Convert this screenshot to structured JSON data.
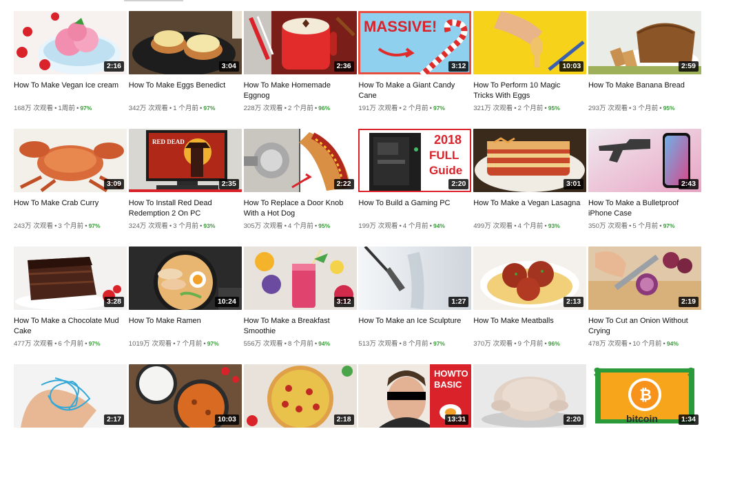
{
  "colors": {
    "percent": "#3a9b3a",
    "duration_bg": "#000000"
  },
  "videos": [
    {
      "title": "How To Make Vegan Ice cream",
      "views": "168万 次观看",
      "age": "1周前",
      "like": "97%",
      "duration": "2:16",
      "thumb": "ice-cream"
    },
    {
      "title": "How To Make Eggs Benedict",
      "views": "342万 次观看",
      "age": "1 个月前",
      "like": "97%",
      "duration": "3:04",
      "thumb": "eggs-benedict"
    },
    {
      "title": "How To Make Homemade Eggnog",
      "views": "228万 次观看",
      "age": "2 个月前",
      "like": "96%",
      "duration": "2:36",
      "thumb": "eggnog"
    },
    {
      "title": "How To Make a Giant Candy Cane",
      "views": "191万 次观看",
      "age": "2 个月前",
      "like": "97%",
      "duration": "3:12",
      "thumb": "candy-cane",
      "thumb_text": "MASSIVE!"
    },
    {
      "title": "How To Perform 10 Magic Tricks With Eggs",
      "views": "321万 次观看",
      "age": "2 个月前",
      "like": "95%",
      "duration": "10:03",
      "thumb": "egg-tricks"
    },
    {
      "title": "How To Make Banana Bread",
      "views": "293万 次观看",
      "age": "3 个月前",
      "like": "95%",
      "duration": "2:59",
      "thumb": "banana-bread"
    },
    {
      "title": "How To Make Crab Curry",
      "views": "243万 次观看",
      "age": "3 个月前",
      "like": "97%",
      "duration": "3:09",
      "thumb": "crab"
    },
    {
      "title": "How To Install Red Dead Redemption 2 On PC",
      "views": "324万 次观看",
      "age": "3 个月前",
      "like": "93%",
      "duration": "2:35",
      "thumb": "red-dead",
      "thumb_text": "RED DEAD"
    },
    {
      "title": "How To Replace a Door Knob With a Hot Dog",
      "views": "305万 次观看",
      "age": "4 个月前",
      "like": "95%",
      "duration": "2:22",
      "thumb": "hotdog"
    },
    {
      "title": "How To Build a Gaming PC",
      "views": "199万 次观看",
      "age": "4 个月前",
      "like": "94%",
      "duration": "2:20",
      "thumb": "gaming-pc",
      "thumb_text": [
        "2018",
        "FULL",
        "Guide"
      ]
    },
    {
      "title": "How To Make a Vegan Lasagna",
      "views": "499万 次观看",
      "age": "4 个月前",
      "like": "93%",
      "duration": "3:01",
      "thumb": "lasagna"
    },
    {
      "title": "How To Make a Bulletproof iPhone Case",
      "views": "350万 次观看",
      "age": "5 个月前",
      "like": "97%",
      "duration": "2:43",
      "thumb": "iphone"
    },
    {
      "title": "How To Make a Chocolate Mud Cake",
      "views": "477万 次观看",
      "age": "6 个月前",
      "like": "97%",
      "duration": "3:28",
      "thumb": "mud-cake"
    },
    {
      "title": "How To Make Ramen",
      "views": "1019万 次观看",
      "age": "7 个月前",
      "like": "97%",
      "duration": "10:24",
      "thumb": "ramen"
    },
    {
      "title": "How To Make a Breakfast Smoothie",
      "views": "556万 次观看",
      "age": "8 个月前",
      "like": "94%",
      "duration": "3:12",
      "thumb": "smoothie"
    },
    {
      "title": "How To Make an Ice Sculpture",
      "views": "513万 次观看",
      "age": "8 个月前",
      "like": "97%",
      "duration": "1:27",
      "thumb": "ice-sculpture"
    },
    {
      "title": "How To Make Meatballs",
      "views": "370万 次观看",
      "age": "9 个月前",
      "like": "96%",
      "duration": "2:13",
      "thumb": "meatballs"
    },
    {
      "title": "How To Cut an Onion Without Crying",
      "views": "478万 次观看",
      "age": "10 个月前",
      "like": "94%",
      "duration": "2:19",
      "thumb": "onion"
    },
    {
      "title": "",
      "views": "",
      "age": "",
      "like": "",
      "duration": "2:17",
      "thumb": "string"
    },
    {
      "title": "",
      "views": "",
      "age": "",
      "like": "",
      "duration": "10:03",
      "thumb": "curry-rice"
    },
    {
      "title": "",
      "views": "",
      "age": "",
      "like": "",
      "duration": "2:18",
      "thumb": "pizza"
    },
    {
      "title": "",
      "views": "",
      "age": "",
      "like": "",
      "duration": "13:31",
      "thumb": "howto-basic",
      "thumb_text": [
        "HOWTO",
        "BASIC"
      ]
    },
    {
      "title": "",
      "views": "",
      "age": "",
      "like": "",
      "duration": "2:20",
      "thumb": "turkey"
    },
    {
      "title": "",
      "views": "",
      "age": "",
      "like": "",
      "duration": "1:34",
      "thumb": "bitcoin",
      "thumb_text": "bitcoin"
    }
  ]
}
